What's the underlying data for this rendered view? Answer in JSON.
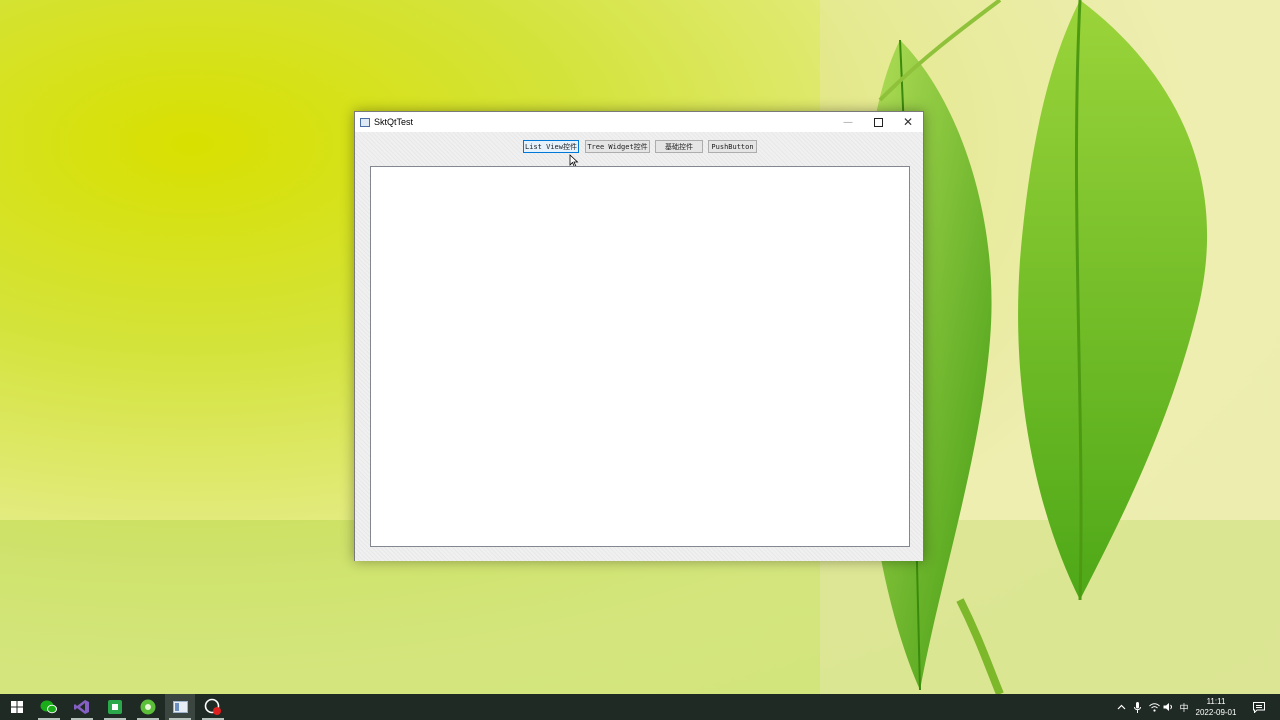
{
  "window": {
    "title": "SktQtTest",
    "controls": {
      "minimize": "—",
      "close": "✕"
    }
  },
  "toolbar": {
    "buttons": [
      {
        "label": "List View控件",
        "active": true
      },
      {
        "label": "Tree Widget控件",
        "active": false
      },
      {
        "label": "基础控件",
        "active": false
      },
      {
        "label": "PushButton",
        "active": false
      }
    ]
  },
  "taskbar": {
    "apps": [
      {
        "icon": "windows-start-icon"
      },
      {
        "icon": "wechat-icon"
      },
      {
        "icon": "visual-studio-icon"
      },
      {
        "icon": "green-app-icon"
      },
      {
        "icon": "green-circle-app-icon"
      },
      {
        "icon": "qt-app-window-icon",
        "active": true
      },
      {
        "icon": "screen-recorder-icon"
      }
    ],
    "tray": {
      "ime_label": "中",
      "time": "11:11",
      "date": "2022-09-01"
    }
  },
  "colors": {
    "taskbar_bg": "#1f2a24",
    "accent": "#0078d7",
    "wallpaper_leaf": "#7cc520"
  }
}
